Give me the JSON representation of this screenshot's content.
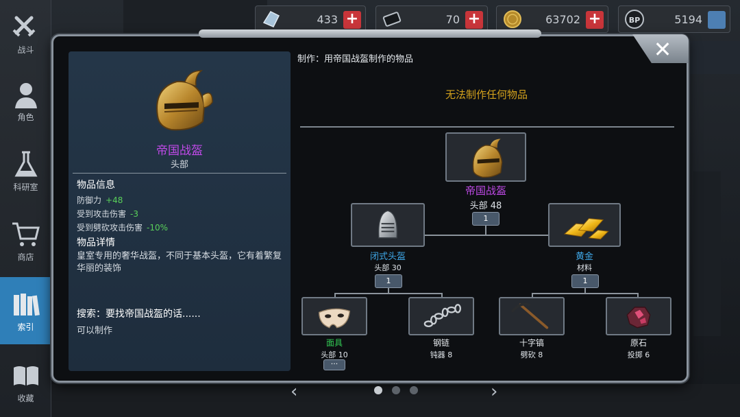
{
  "sidebar": {
    "items": [
      {
        "label": "战斗",
        "icon": "crossed-swords-icon"
      },
      {
        "label": "角色",
        "icon": "character-icon"
      },
      {
        "label": "科研室",
        "icon": "flask-icon"
      },
      {
        "label": "商店",
        "icon": "cart-icon"
      },
      {
        "label": "索引",
        "icon": "books-icon",
        "active": true
      },
      {
        "label": "收藏",
        "icon": "open-book-icon"
      }
    ]
  },
  "currency": [
    {
      "icon": "gem-icon",
      "amount": "433",
      "action": "plus"
    },
    {
      "icon": "ticket-icon",
      "amount": "70",
      "action": "plus"
    },
    {
      "icon": "coin-icon",
      "amount": "63702",
      "action": "plus"
    },
    {
      "icon": "bp-icon",
      "amount": "5194",
      "action": "card"
    }
  ],
  "item": {
    "name": "帝国战盔",
    "slot": "头部",
    "info_title": "物品信息",
    "stats": [
      {
        "label": "防御力",
        "value": "+48"
      },
      {
        "label": "受到攻击伤害",
        "value": "-3"
      },
      {
        "label": "受到劈砍攻击伤害",
        "value": "-10%"
      }
    ],
    "detail_title": "物品详情",
    "description": "皇室专用的奢华战盔，不同于基本头盔，它有着繁复华丽的装饰",
    "search": "搜索：要找帝国战盔的话......",
    "craftable": "可以制作"
  },
  "recipe": {
    "header": "制作：用帝国战盔制作的物品",
    "no_craft": "无法制作任何物品",
    "root": {
      "name": "帝国战盔",
      "sub": "头部 48",
      "qty": "1"
    },
    "mid": [
      {
        "name": "闭式头盔",
        "sub": "头部 30",
        "qty": "1"
      },
      {
        "name": "黄金",
        "sub": "材料",
        "qty": "1"
      }
    ],
    "leaves": [
      {
        "name": "面具",
        "sub": "头部 10",
        "qty": "···"
      },
      {
        "name": "钢链",
        "sub": "钝器 8"
      },
      {
        "name": "十字镐",
        "sub": "劈砍 8"
      },
      {
        "name": "原石",
        "sub": "投掷 6"
      }
    ]
  },
  "colors": {
    "rare": "#c04ae8",
    "uncommon": "#3fa8e8",
    "common_green": "#33cc55",
    "gold": "#d4a21c",
    "accent": "#2f7fb8"
  },
  "pager": {
    "pages": 3,
    "current": 1
  }
}
